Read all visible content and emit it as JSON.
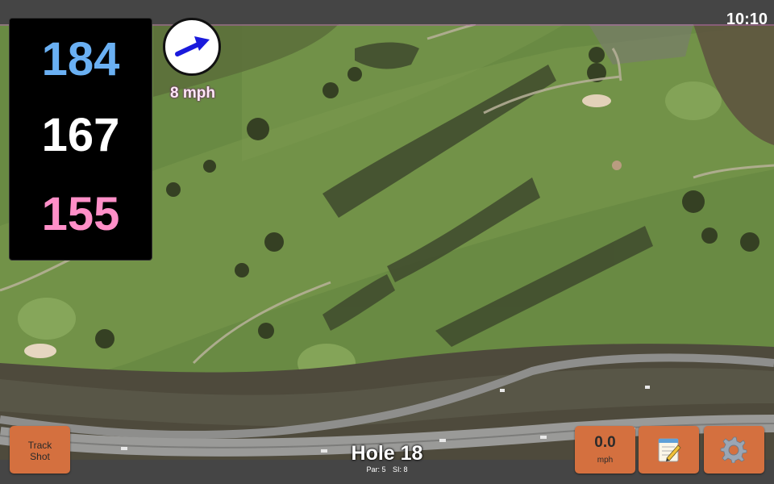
{
  "status_bar": {
    "time": "10:10"
  },
  "distances": {
    "back": "184",
    "middle": "167",
    "front": "155"
  },
  "wind": {
    "speed": "8 mph",
    "icon": "wind-arrow-icon"
  },
  "hole": {
    "title": "Hole 18",
    "par": "Par: 5",
    "si": "SI: 8"
  },
  "buttons": {
    "track_shot_line1": "Track",
    "track_shot_line2": "Shot",
    "speed_value": "0.0",
    "speed_unit": "mph",
    "notes_icon": "notepad-icon",
    "settings_icon": "gear-icon"
  },
  "colors": {
    "back_distance": "#6ab0f3",
    "middle_distance": "#ffffff",
    "front_distance": "#ff8fc8",
    "button": "#d4703f",
    "wind_arrow": "#1a1adc"
  }
}
